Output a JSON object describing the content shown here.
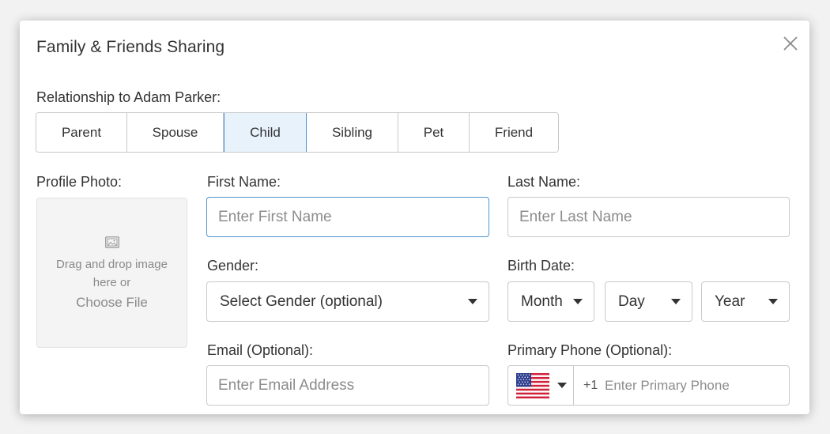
{
  "dialog": {
    "title": "Family & Friends Sharing"
  },
  "relationship": {
    "label": "Relationship to Adam Parker:",
    "options": [
      "Parent",
      "Spouse",
      "Child",
      "Sibling",
      "Pet",
      "Friend"
    ],
    "selected": "Child"
  },
  "profile_photo": {
    "label": "Profile Photo:",
    "drop_text_line1": "Drag and drop image",
    "drop_text_line2": "here or",
    "choose_file": "Choose File",
    "icon": "image-icon"
  },
  "first_name": {
    "label": "First Name:",
    "placeholder": "Enter First Name",
    "value": ""
  },
  "last_name": {
    "label": "Last Name:",
    "placeholder": "Enter Last Name",
    "value": ""
  },
  "gender": {
    "label": "Gender:",
    "selected": "Select Gender (optional)"
  },
  "birth_date": {
    "label": "Birth Date:",
    "month": "Month",
    "day": "Day",
    "year": "Year"
  },
  "email": {
    "label": "Email (Optional):",
    "placeholder": "Enter Email Address",
    "value": ""
  },
  "phone": {
    "label": "Primary Phone (Optional):",
    "country_icon": "us-flag-icon",
    "dial_code": "+1",
    "placeholder": "Enter Primary Phone",
    "value": ""
  },
  "colors": {
    "accent": "#4f93d2",
    "selected_bg": "#e8f2fb",
    "border": "#c9c9c9"
  }
}
